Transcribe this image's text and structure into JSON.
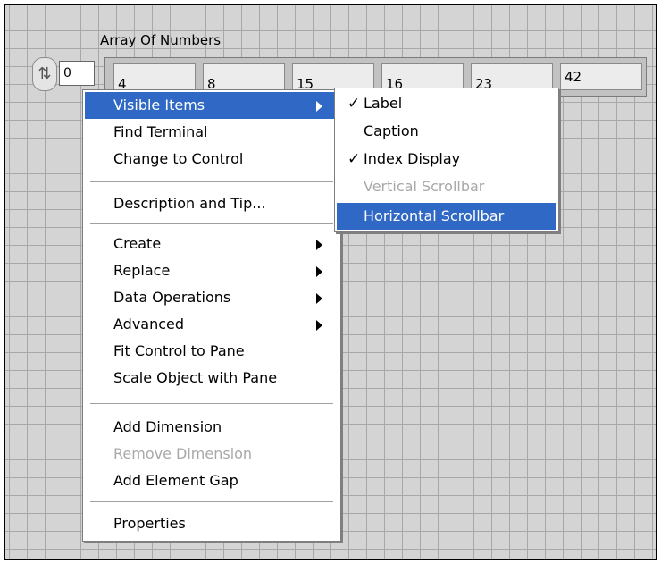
{
  "array": {
    "label": "Array Of Numbers",
    "index_value": "0",
    "stepper_glyph": "⇅",
    "values": [
      "4",
      "8",
      "15",
      "16",
      "23",
      "42"
    ]
  },
  "context_menu": {
    "items": [
      {
        "label": "Visible Items",
        "has_submenu": true,
        "selected": true
      },
      {
        "label": "Find Terminal"
      },
      {
        "label": "Change to Control"
      },
      {
        "label": "Description and Tip..."
      },
      {
        "label": "Create",
        "has_submenu": true
      },
      {
        "label": "Replace",
        "has_submenu": true
      },
      {
        "label": "Data Operations",
        "has_submenu": true
      },
      {
        "label": "Advanced",
        "has_submenu": true
      },
      {
        "label": "Fit Control to Pane"
      },
      {
        "label": "Scale Object with Pane"
      },
      {
        "label": "Add Dimension"
      },
      {
        "label": "Remove Dimension",
        "disabled": true
      },
      {
        "label": "Add Element Gap"
      },
      {
        "label": "Properties"
      }
    ]
  },
  "submenu": {
    "check_glyph": "✓",
    "items": [
      {
        "label": "Label",
        "checked": true
      },
      {
        "label": "Caption"
      },
      {
        "label": "Index Display",
        "checked": true
      },
      {
        "label": "Vertical Scrollbar",
        "disabled": true
      },
      {
        "label": "Horizontal Scrollbar",
        "selected": true
      }
    ]
  },
  "colors": {
    "selection": "#3068c6",
    "disabled_text": "#a8a8a8",
    "panel_grid": "#a8a8a8",
    "panel_bg": "#d4d4d4"
  }
}
